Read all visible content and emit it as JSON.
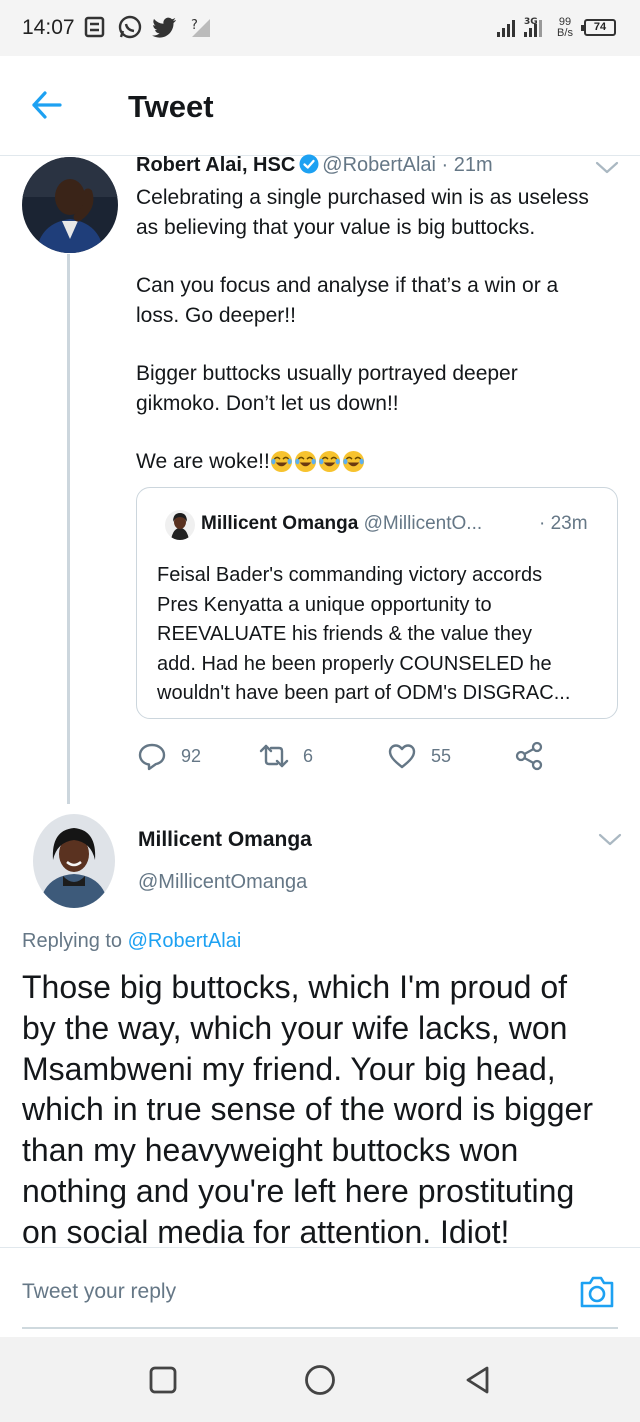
{
  "status_bar": {
    "time": "14:07",
    "net_speed_value": "99",
    "net_speed_unit": "B/s",
    "battery": "74",
    "icons": [
      "notification-icon",
      "whatsapp-icon",
      "twitter-icon",
      "wifi-unknown-icon",
      "signal-icon",
      "signal-3g-icon"
    ]
  },
  "header": {
    "title": "Tweet",
    "back_icon": "arrow-left-icon",
    "accent_color": "#1da1f2"
  },
  "main_tweet": {
    "author_name": "Robert Alai, HSC",
    "handle": "@RobertAlai",
    "separator": "·",
    "time": "21m",
    "paragraphs": [
      [
        "Celebrating a single purchased win is as useless",
        "as believing that your value is big buttocks."
      ],
      [
        "Can you focus and analyse if that’s a win or a",
        "loss. Go deeper!!"
      ],
      [
        "Bigger buttocks usually portrayed deeper",
        "gikmoko. Don’t let us down!!"
      ]
    ],
    "last_line": "We are woke!!",
    "emoji_count": 4,
    "emoji_name": "face-with-tears-of-joy-icon",
    "quoted": {
      "author_name": "Millicent Omanga",
      "handle": "@MillicentO...",
      "time": "· 23m",
      "lines": [
        "Feisal Bader's commanding victory accords",
        "Pres Kenyatta a unique opportunity to",
        "REEVALUATE his friends & the value they",
        "add. Had he been properly COUNSELED he",
        "wouldn't have been part of ODM's DISGRAC..."
      ]
    },
    "actions": {
      "replies": "92",
      "retweets": "6",
      "likes": "55"
    }
  },
  "reply_tweet": {
    "author_name": "Millicent Omanga",
    "handle": "@MillicentOmanga",
    "replying_prefix": "Replying to",
    "replying_to": "@RobertAlai",
    "lines": [
      "Those big buttocks, which I'm proud of",
      "by the way, which your wife lacks, won",
      "Msambweni my friend. Your big head,",
      "which in true sense of the word is bigger",
      "than my heavyweight buttocks won",
      "nothing and you're left here prostituting",
      "on social media for attention. Idiot!"
    ]
  },
  "reply_bar": {
    "placeholder": "Tweet your reply",
    "camera_icon": "camera-icon"
  },
  "nav_bar": {
    "icons": [
      "recents-square-icon",
      "home-circle-icon",
      "back-triangle-icon"
    ]
  }
}
